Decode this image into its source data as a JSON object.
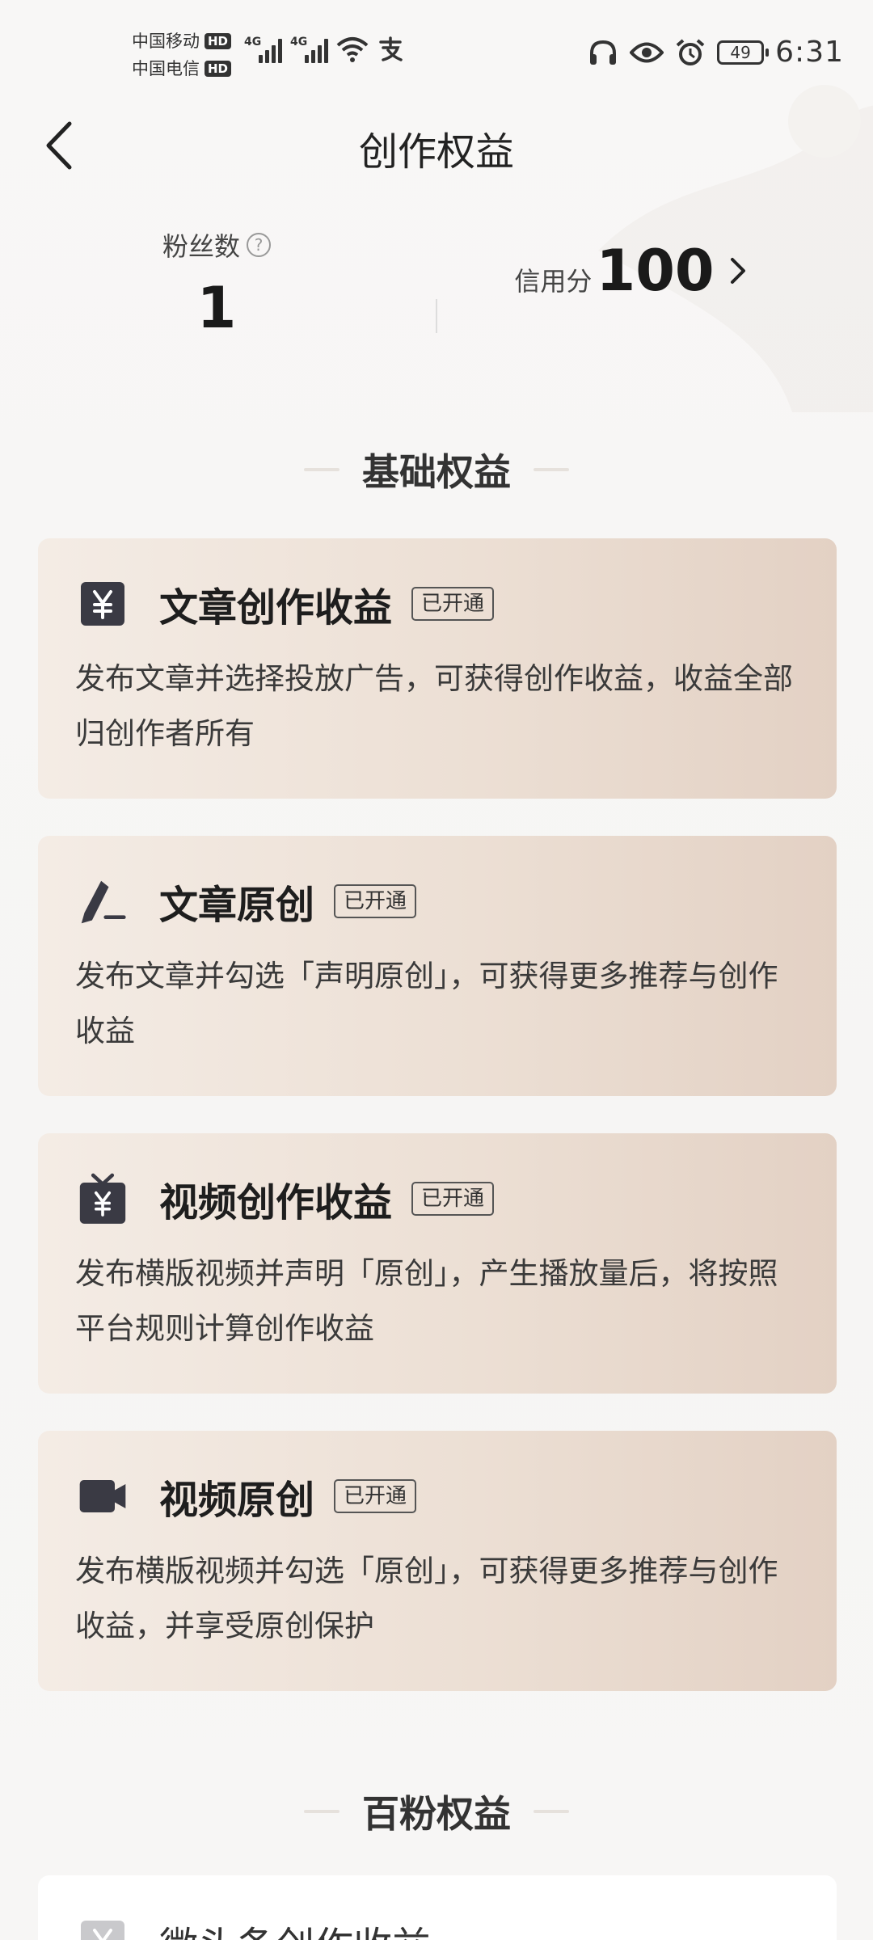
{
  "status_bar": {
    "carrier1": "中国移动",
    "carrier2": "中国电信",
    "hd": "HD",
    "net1": "4G",
    "net2": "4G",
    "battery": "49",
    "time": "6:31",
    "icons": [
      "headphones-icon",
      "eye-icon",
      "alarm-icon",
      "wifi-icon",
      "alipay-icon"
    ]
  },
  "header": {
    "title": "创作权益"
  },
  "stats": {
    "fans": {
      "label": "粉丝数",
      "value": "1"
    },
    "credit": {
      "label": "信用分",
      "value": "100"
    }
  },
  "sections": {
    "basic": {
      "title": "基础权益"
    },
    "hundred": {
      "title": "百粉权益"
    }
  },
  "cards": [
    {
      "icon": "yuan-icon",
      "title": "文章创作收益",
      "badge": "已开通",
      "desc": "发布文章并选择投放广告，可获得创作收益，收益全部归创作者所有"
    },
    {
      "icon": "pen-icon",
      "title": "文章原创",
      "badge": "已开通",
      "desc": "发布文章并勾选「声明原创」，可获得更多推荐与创作收益"
    },
    {
      "icon": "tv-yuan-icon",
      "title": "视频创作收益",
      "badge": "已开通",
      "desc": "发布横版视频并声明「原创」，产生播放量后，将按照平台规则计算创作收益"
    },
    {
      "icon": "video-camera-icon",
      "title": "视频原创",
      "badge": "已开通",
      "desc": "发布横版视频并勾选「原创」，可获得更多推荐与创作收益，并享受原创保护"
    }
  ],
  "partial_card": {
    "icon": "yuan-icon",
    "title": "微头条创作收益"
  },
  "colors": {
    "card_start": "#f4ece5",
    "card_end": "#e3d1c4",
    "text": "#222222"
  }
}
